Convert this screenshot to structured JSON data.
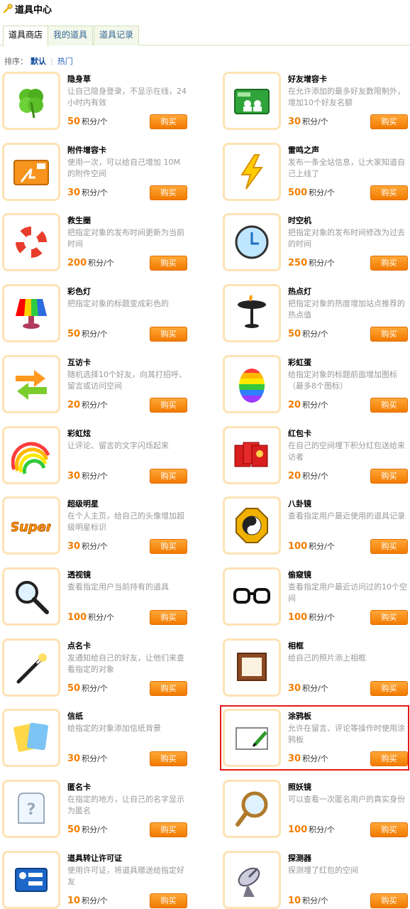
{
  "header": {
    "title": "道具中心"
  },
  "tabs": [
    "道具商店",
    "我的道具",
    "道具记录"
  ],
  "sort": {
    "label": "排序：",
    "default": "默认",
    "hot": "热门"
  },
  "unit": "积分/个",
  "buy_label": "购买",
  "items": [
    {
      "name": "隐身草",
      "desc": "让自己隐身登录，不显示在线，24小时内有效",
      "price": "50",
      "icon": "clover-icon"
    },
    {
      "name": "好友增容卡",
      "desc": "在允许添加的最多好友数限制外，增加10个好友名额",
      "price": "30",
      "icon": "friend-card-icon"
    },
    {
      "name": "附件增容卡",
      "desc": "使用一次，可以给自己增加 10M 的附件空间",
      "price": "30",
      "icon": "attachment-card-icon"
    },
    {
      "name": "雷鸣之声",
      "desc": "发布一条全站信息，让大家知道自己上线了",
      "price": "500",
      "icon": "lightning-icon"
    },
    {
      "name": "救生圈",
      "desc": "把指定对象的发布时间更新为当前时间",
      "price": "200",
      "icon": "lifebuoy-icon"
    },
    {
      "name": "时空机",
      "desc": "把指定对象的发布时间修改为过去的时间",
      "price": "250",
      "icon": "clock-icon"
    },
    {
      "name": "彩色灯",
      "desc": "把指定对象的标题变成彩色的",
      "price": "50",
      "icon": "color-lamp-icon"
    },
    {
      "name": "热点灯",
      "desc": "把指定对象的热度增加站点推荐的热点值",
      "price": "50",
      "icon": "hot-lamp-icon"
    },
    {
      "name": "互访卡",
      "desc": "随机选择10个好友，向其打招呼、留言或访问空间",
      "price": "20",
      "icon": "arrows-icon"
    },
    {
      "name": "彩虹蛋",
      "desc": "给指定对象的标题前面增加图标（最多8个图标）",
      "price": "20",
      "icon": "rainbow-egg-icon"
    },
    {
      "name": "彩虹炫",
      "desc": "让评论、留言的文字闪烁起来",
      "price": "30",
      "icon": "rainbow-icon"
    },
    {
      "name": "红包卡",
      "desc": "在自己的空间埋下积分红包送给来访者",
      "price": "20",
      "icon": "red-envelope-icon"
    },
    {
      "name": "超级明星",
      "desc": "在个人主页，给自己的头像增加超级明星标识",
      "price": "30",
      "icon": "super-star-icon"
    },
    {
      "name": "八卦镜",
      "desc": "查看指定用户最近使用的道具记录",
      "price": "100",
      "icon": "bagua-mirror-icon"
    },
    {
      "name": "透视镜",
      "desc": "查看指定用户当前持有的道具",
      "price": "100",
      "icon": "magnifier-icon"
    },
    {
      "name": "偷窥镜",
      "desc": "查看指定用户最近访问过的10个空间",
      "price": "100",
      "icon": "glasses-icon"
    },
    {
      "name": "点名卡",
      "desc": "发通知给自己的好友，让他们来查看指定的对象",
      "price": "50",
      "icon": "magic-wand-icon"
    },
    {
      "name": "相框",
      "desc": "给自己的照片添上相框",
      "price": "30",
      "icon": "photo-frame-icon"
    },
    {
      "name": "信纸",
      "desc": "给指定的对象添加信纸背景",
      "price": "30",
      "icon": "letter-paper-icon"
    },
    {
      "name": "涂鸦板",
      "desc": "允许在留言、评论等操作时使用涂鸦板",
      "price": "30",
      "icon": "doodle-board-icon"
    },
    {
      "name": "匿名卡",
      "desc": "在指定的地方，让自己的名字显示为匿名",
      "price": "50",
      "icon": "anonymous-card-icon"
    },
    {
      "name": "照妖镜",
      "desc": "可以查看一次匿名用户的真实身份",
      "price": "100",
      "icon": "hand-mirror-icon"
    },
    {
      "name": "道具转让许可证",
      "desc": "使用许可证，将道具赠送给指定好友",
      "price": "10",
      "icon": "transfer-license-icon"
    },
    {
      "name": "探测器",
      "desc": "探测埋了红包的空间",
      "price": "10",
      "icon": "satellite-dish-icon"
    }
  ]
}
